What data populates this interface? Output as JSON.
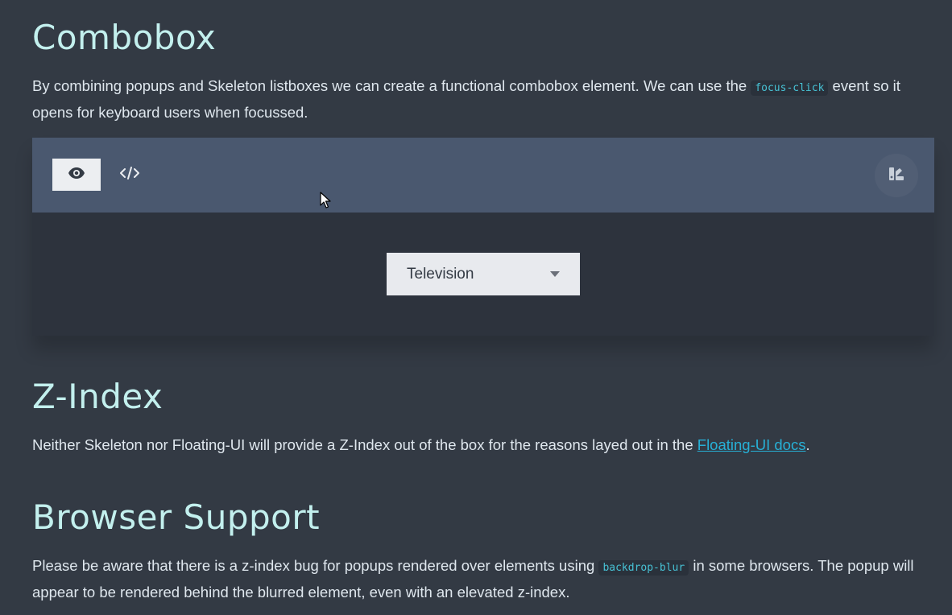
{
  "sections": {
    "combobox": {
      "title": "Combobox",
      "text_before": "By combining popups and Skeleton listboxes we can create a functional combobox element. We can use the ",
      "code": "focus-click",
      "text_after": " event so it opens for keyboard users when focussed."
    },
    "zindex": {
      "title": "Z-Index",
      "text_before": "Neither Skeleton nor Floating-UI will provide a Z-Index out of the box for the reasons layed out in the ",
      "link": "Floating-UI docs",
      "text_after": "."
    },
    "browser": {
      "title": "Browser Support",
      "text_before": "Please be aware that there is a z-index bug for popups rendered over elements using ",
      "code": "backdrop-blur",
      "text_after": " in some browsers. The popup will appear to be rendered behind the blurred element, even with an elevated z-index."
    }
  },
  "preview": {
    "icons": {
      "preview": "eye-icon",
      "code": "code-icon",
      "theme": "swatch-icon"
    },
    "combobox_value": "Television"
  },
  "colors": {
    "background": "#333a44",
    "heading": "#c3f0ee",
    "toolbar": "#4a586f",
    "link": "#27b0d6",
    "code": "#47c1d4"
  }
}
